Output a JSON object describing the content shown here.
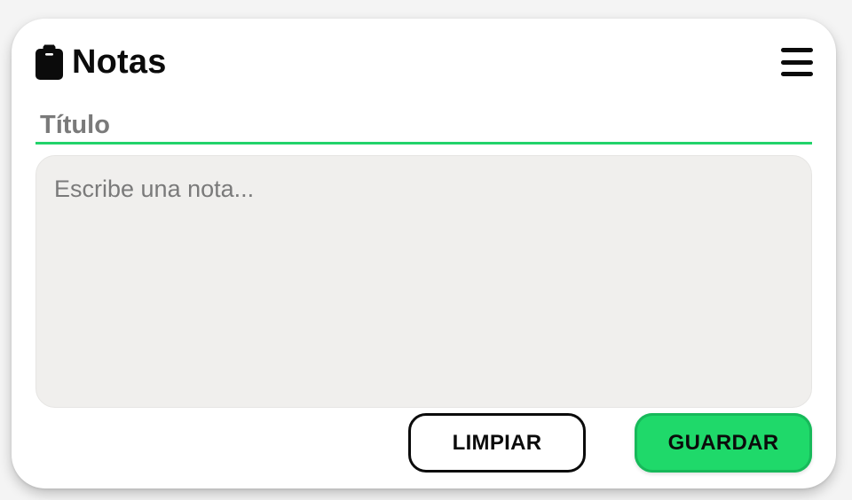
{
  "app": {
    "title": "Notas",
    "icon": "clipboard-icon",
    "menu_icon": "hamburger-menu-icon"
  },
  "form": {
    "title_placeholder": "Título",
    "title_value": "",
    "note_placeholder": "Escribe una nota...",
    "note_value": ""
  },
  "actions": {
    "clear_label": "LIMPIAR",
    "save_label": "GUARDAR"
  },
  "colors": {
    "accent": "#1fd96a",
    "underline": "#22d36a",
    "text": "#0b0b0b",
    "note_background": "#f0efed"
  }
}
